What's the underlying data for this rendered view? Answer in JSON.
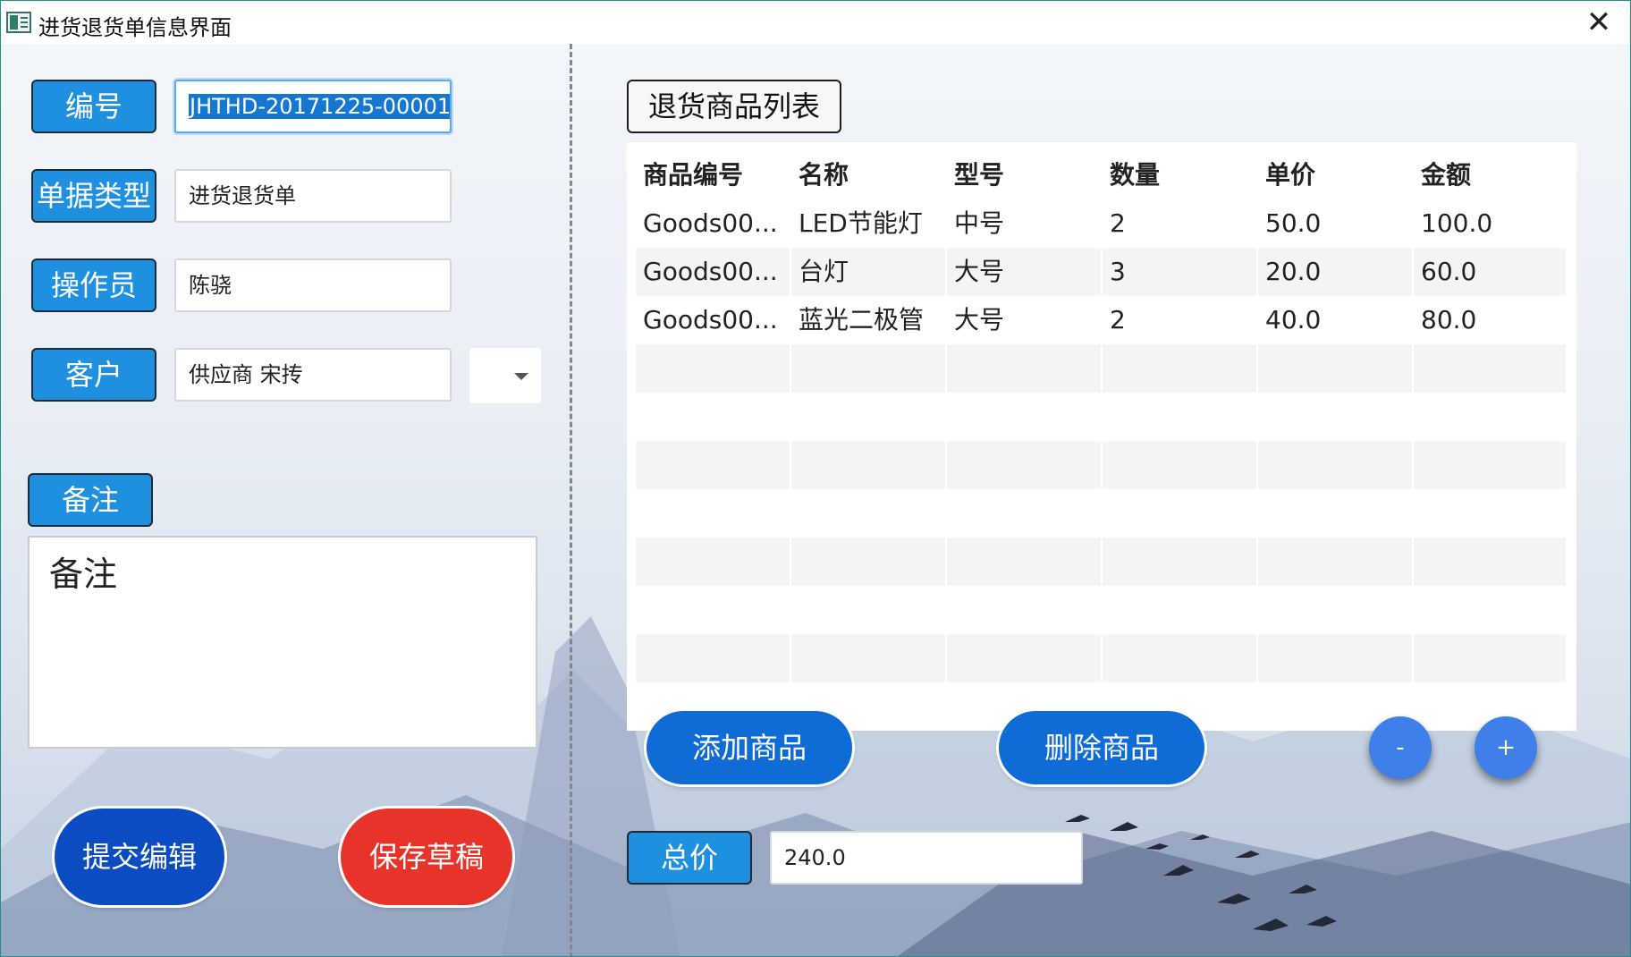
{
  "window": {
    "title": "进货退货单信息界面",
    "close_glyph": "✕"
  },
  "form": {
    "id_label": "编号",
    "id_value": "JHTHD-20171225-00001",
    "type_label": "单据类型",
    "type_value": "进货退货单",
    "operator_label": "操作员",
    "operator_value": "陈骁",
    "customer_label": "客户",
    "customer_value": "供应商 宋抟",
    "notes_label": "备注",
    "notes_value": "备注"
  },
  "actions": {
    "submit": "提交编辑",
    "save_draft": "保存草稿"
  },
  "goods": {
    "section_title": "退货商品列表",
    "columns": [
      "商品编号",
      "名称",
      "型号",
      "数量",
      "单价",
      "金额"
    ],
    "rows": [
      [
        "Goods00...",
        "LED节能灯",
        "中号",
        "2",
        "50.0",
        "100.0"
      ],
      [
        "Goods00...",
        "台灯",
        "大号",
        "3",
        "20.0",
        "60.0"
      ],
      [
        "Goods00...",
        "蓝光二极管",
        "大号",
        "2",
        "40.0",
        "80.0"
      ]
    ],
    "add_button": "添加商品",
    "delete_button": "删除商品",
    "minus_button": "-",
    "plus_button": "+"
  },
  "total": {
    "label": "总价",
    "value": "240.0"
  },
  "colors": {
    "accent": "#1f8fe0",
    "submit": "#0b4cc2",
    "draft": "#e8332a",
    "round": "#3e7fe9"
  }
}
